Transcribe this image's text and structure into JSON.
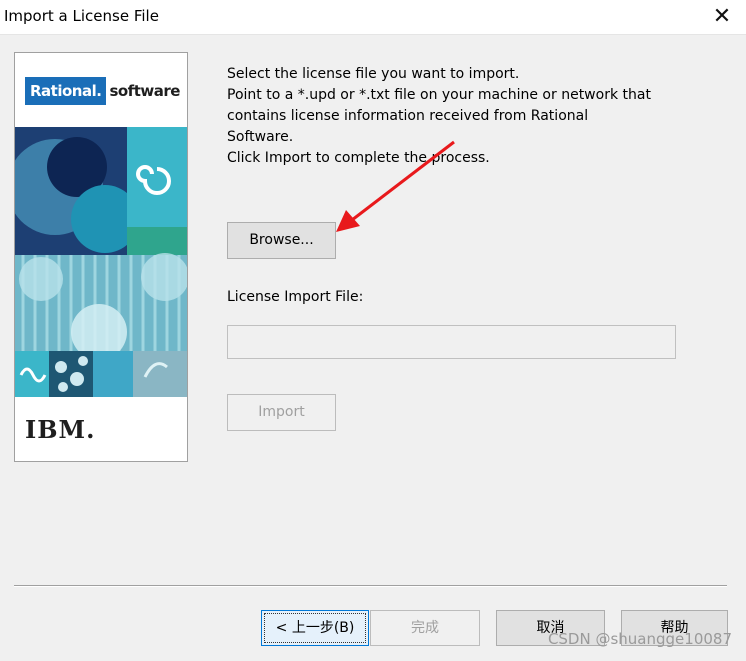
{
  "window": {
    "title": "Import a License File",
    "close_glyph": "✕"
  },
  "branding": {
    "logo_word1": "Rational.",
    "logo_word2": "software",
    "footer_logo": "IBM."
  },
  "instructions": {
    "lines": [
      "Select the license file you want to import.",
      "Point to a *.upd or *.txt file on your machine or network that",
      "contains license information received from Rational",
      "Software.",
      "Click Import to complete the process."
    ]
  },
  "browse": {
    "label": "Browse..."
  },
  "import_file": {
    "label": "License Import File:",
    "value": ""
  },
  "import": {
    "label": "Import",
    "enabled": false
  },
  "footer": {
    "back_label": "< 上一步(B)",
    "finish_label": "完成",
    "cancel_label": "取消",
    "help_label": "帮助"
  },
  "watermark": "CSDN @shuangge10087",
  "colors": {
    "accent": "#0078d7",
    "annotation_arrow": "#e8191c",
    "logo_blue": "#1a6eb8"
  }
}
